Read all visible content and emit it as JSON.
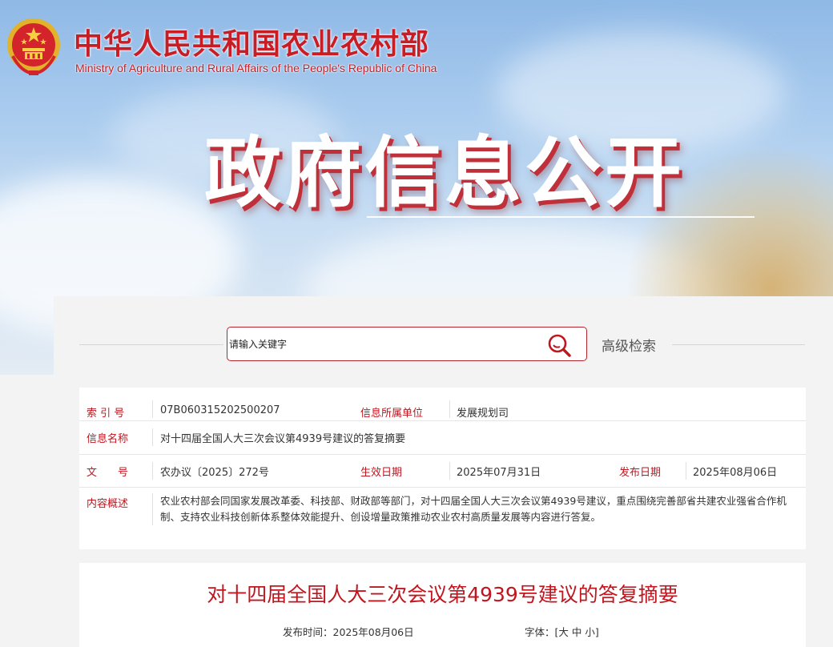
{
  "header": {
    "brand_name": "中华人民共和国农业农村部",
    "brand_subtitle": "Ministry of Agriculture and Rural Affairs of the People's Republic of China",
    "section_title": "政府信息公开",
    "emblem_icon": "national-emblem-icon"
  },
  "search": {
    "placeholder": "请输入关键字",
    "advanced_label": "高级检索",
    "icon": "search-icon",
    "accent_color": "#b8232d"
  },
  "info": {
    "index_label": "索 引 号",
    "index_value": "07B060315202500207",
    "unit_label": "信息所属单位",
    "unit_value": "发展规划司",
    "name_label": "信息名称",
    "name_value": "对十四届全国人大三次会议第4939号建议的答复摘要",
    "doc_label": "文　　号",
    "doc_value": "农办议〔2025〕272号",
    "effective_label": "生效日期",
    "effective_value": "2025年07月31日",
    "publish_label": "发布日期",
    "publish_value": "2025年08月06日",
    "summary_label": "内容概述",
    "summary_value": "农业农村部会同国家发展改革委、科技部、财政部等部门，对十四届全国人大三次会议第4939号建议，重点围绕完善部省共建农业强省合作机制、支持农业科技创新体系整体效能提升、创设增量政策推动农业农村高质量发展等内容进行答复。"
  },
  "article": {
    "title": "对十四届全国人大三次会议第4939号建议的答复摘要",
    "publish_time": "发布时间：2025年08月06日",
    "font_label": "字体：[",
    "font_large": "大",
    "font_medium": "中",
    "font_small": "小",
    "font_close": "]"
  },
  "colors": {
    "brand_red": "#c81d25",
    "label_red": "#c0161f"
  }
}
